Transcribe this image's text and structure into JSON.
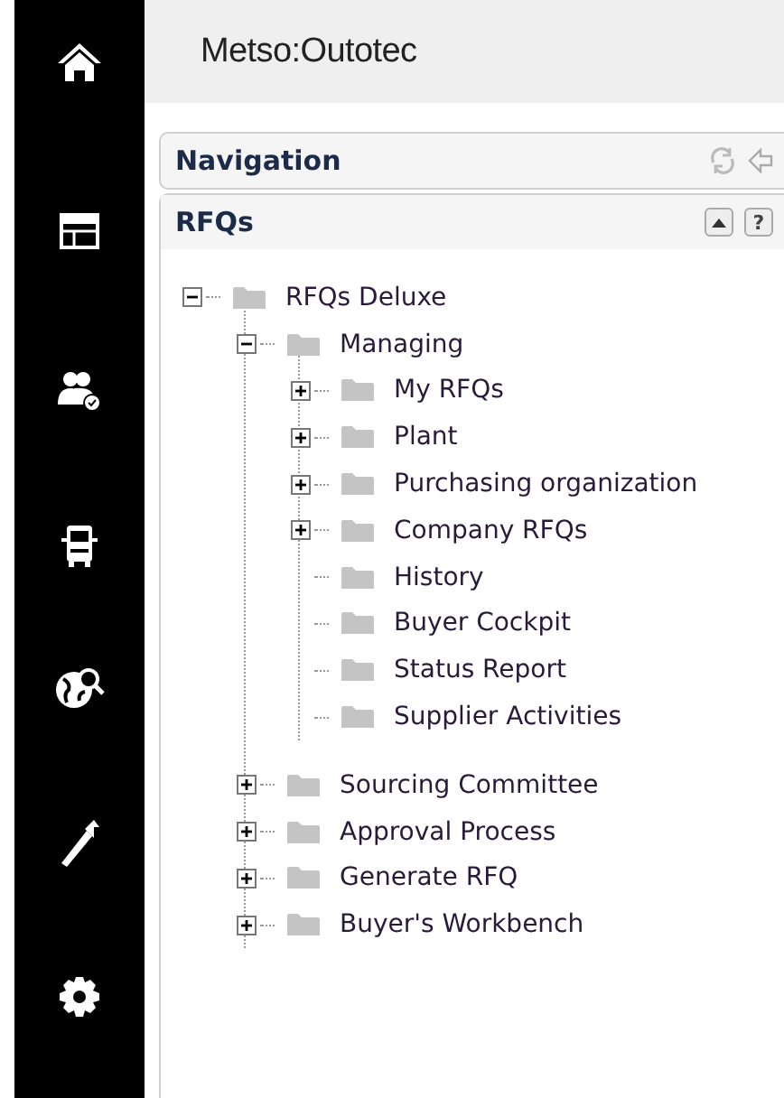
{
  "header": {
    "logo": "Metso:Outotec"
  },
  "navigation_panel": {
    "title": "Navigation"
  },
  "rfqs_panel": {
    "title": "RFQs",
    "help": "?"
  },
  "tree": [
    {
      "label": "RFQs Deluxe",
      "kind": "branch",
      "expanded": true,
      "children": [
        {
          "label": "Managing",
          "kind": "branch",
          "expanded": true,
          "children": [
            {
              "label": "My RFQs",
              "kind": "branch",
              "expanded": false
            },
            {
              "label": "Plant",
              "kind": "branch",
              "expanded": false
            },
            {
              "label": "Purchasing organization",
              "kind": "branch",
              "expanded": false
            },
            {
              "label": "Company RFQs",
              "kind": "branch",
              "expanded": false
            },
            {
              "label": "History",
              "kind": "leaf"
            },
            {
              "label": "Buyer Cockpit",
              "kind": "leaf"
            },
            {
              "label": "Status Report",
              "kind": "leaf"
            },
            {
              "label": "Supplier Activities",
              "kind": "leaf"
            }
          ]
        },
        {
          "label": "Sourcing Committee",
          "kind": "branch",
          "expanded": false
        },
        {
          "label": "Approval Process",
          "kind": "branch",
          "expanded": false
        },
        {
          "label": "Generate RFQ",
          "kind": "branch",
          "expanded": false
        },
        {
          "label": "Buyer's Workbench",
          "kind": "branch",
          "expanded": false
        }
      ]
    }
  ]
}
